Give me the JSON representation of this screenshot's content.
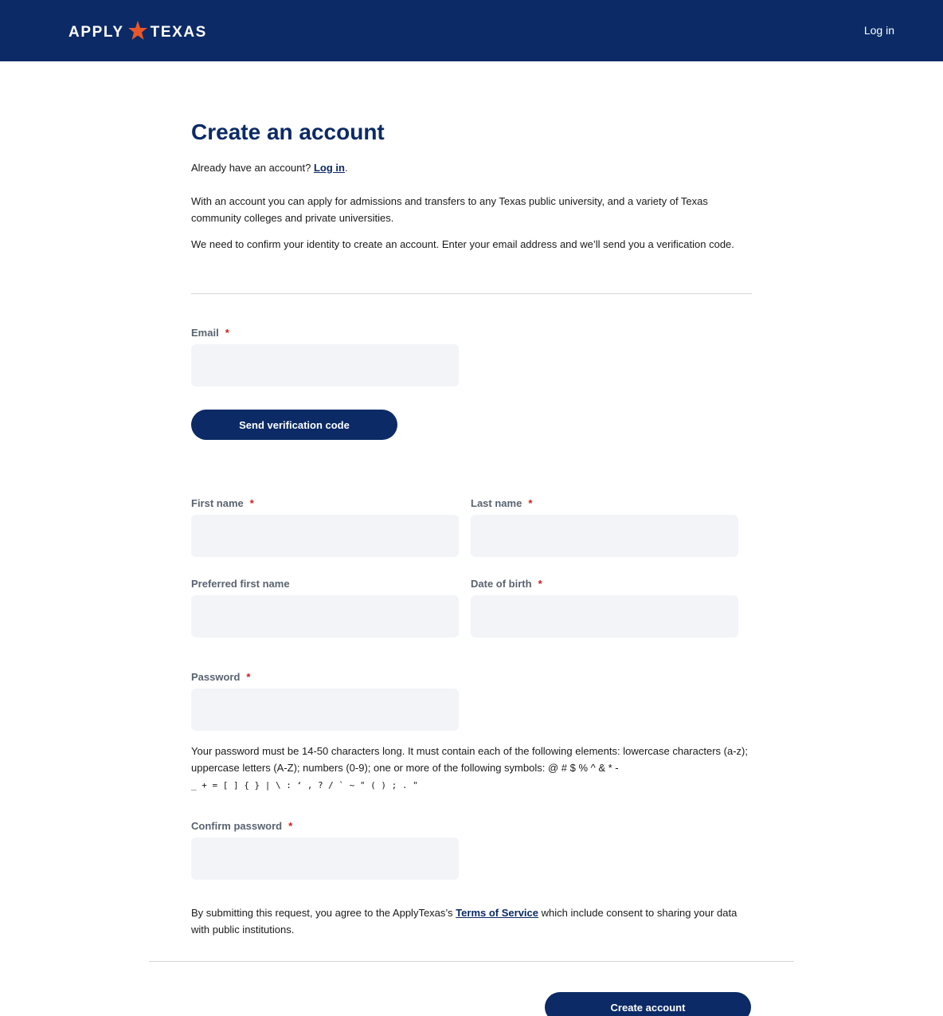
{
  "header": {
    "logo_left": "APPLY",
    "logo_right": "TEXAS",
    "login_link": "Log in"
  },
  "intro": {
    "title": "Create an account",
    "already_text": "Already have an account?",
    "login_link": "Log in",
    "already_suffix": ".",
    "description": "With an account you can apply for admissions and transfers to any Texas public university, and a variety of Texas community colleges and private universities.",
    "verify_note": "We need to confirm your identity to create an account. Enter your email address and we’ll send you a verification code."
  },
  "form": {
    "required_marker": "*",
    "email_label": "Email",
    "email_value": "",
    "send_code_button": "Send verification code",
    "first_name_label": "First name",
    "last_name_label": "Last name",
    "preferred_name_label": "Preferred first name",
    "dob_label": "Date of birth",
    "password_label": "Password",
    "password_hint": "Your password must be 14-50 characters long. It must contain each of the following elements: lowercase characters (a-z); uppercase letters (A-Z); numbers (0-9); one or more of the following symbols: @ # $ % ^ & * -",
    "password_hint_symbols": "_ + = [ ] { } | \\ : ‘ , ? / ` ~ \" ( ) ; . \"",
    "confirm_password_label": "Confirm password"
  },
  "terms": {
    "text_before": "By submitting this request, you agree to the ApplyTexas’s",
    "link": "Terms of Service",
    "text_after": "which include consent to sharing your data with public institutions."
  },
  "footer": {
    "create_button": "Create account"
  },
  "colors": {
    "brand_navy": "#0b2a66",
    "star_orange": "#e8572a",
    "required_red": "#d11a1a",
    "input_bg": "#f3f4f7"
  }
}
